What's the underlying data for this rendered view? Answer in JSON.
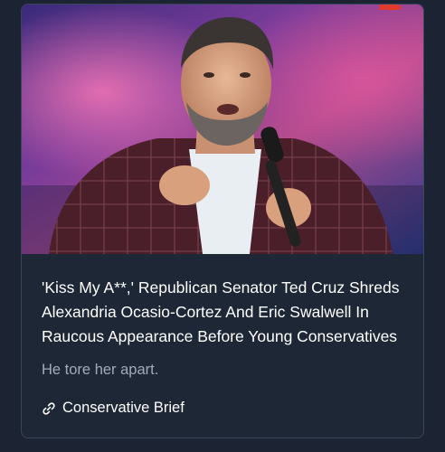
{
  "card": {
    "title": "'Kiss My A**,' Republican Senator Ted Cruz Shreds Alexandria Ocasio-Cortez And Eric Swalwell In Raucous Appearance Before Young Conservatives",
    "description": "He tore her apart.",
    "source": "Conservative Brief",
    "source_icon": "link-icon",
    "image_subject": "photo-thumbnail"
  }
}
